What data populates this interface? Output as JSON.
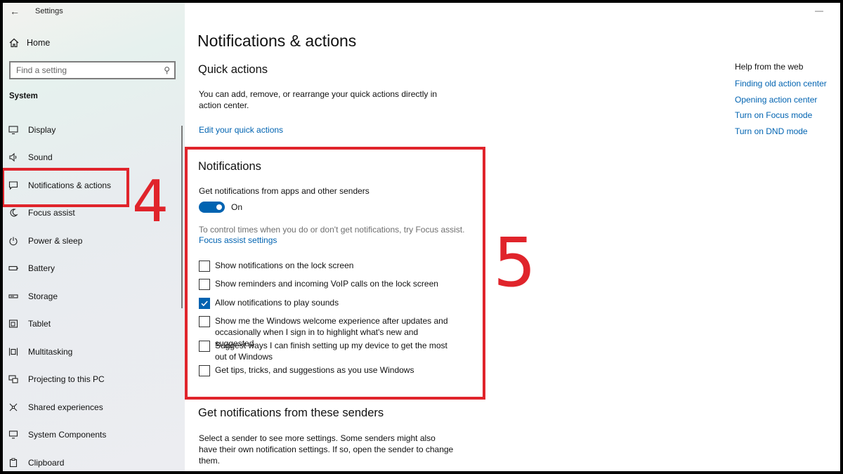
{
  "window": {
    "title": "Settings"
  },
  "sidebar": {
    "home_label": "Home",
    "search_placeholder": "Find a setting",
    "section_label": "System",
    "items": [
      {
        "label": "Display",
        "icon": "monitor-icon"
      },
      {
        "label": "Sound",
        "icon": "speaker-icon"
      },
      {
        "label": "Notifications & actions",
        "icon": "notification-icon"
      },
      {
        "label": "Focus assist",
        "icon": "moon-icon"
      },
      {
        "label": "Power & sleep",
        "icon": "power-icon"
      },
      {
        "label": "Battery",
        "icon": "battery-icon"
      },
      {
        "label": "Storage",
        "icon": "storage-icon"
      },
      {
        "label": "Tablet",
        "icon": "tablet-icon"
      },
      {
        "label": "Multitasking",
        "icon": "multitasking-icon"
      },
      {
        "label": "Projecting to this PC",
        "icon": "projecting-icon"
      },
      {
        "label": "Shared experiences",
        "icon": "shared-icon"
      },
      {
        "label": "System Components",
        "icon": "components-icon"
      },
      {
        "label": "Clipboard",
        "icon": "clipboard-icon"
      }
    ]
  },
  "main": {
    "page_title": "Notifications & actions",
    "quick_actions": {
      "heading": "Quick actions",
      "description": "You can add, remove, or rearrange your quick actions directly in action center.",
      "link": "Edit your quick actions"
    },
    "notifications": {
      "heading": "Notifications",
      "toggle_label_text": "Get notifications from apps and other senders",
      "toggle_state": "On",
      "focus_hint": "To control times when you do or don't get notifications, try Focus assist.",
      "focus_link": "Focus assist settings",
      "options": [
        {
          "label": "Show notifications on the lock screen",
          "checked": false
        },
        {
          "label": "Show reminders and incoming VoIP calls on the lock screen",
          "checked": false
        },
        {
          "label": "Allow notifications to play sounds",
          "checked": true
        },
        {
          "label": "Show me the Windows welcome experience after updates and occasionally when I sign in to highlight what's new and suggested",
          "checked": false
        },
        {
          "label": "Suggest ways I can finish setting up my device to get the most out of Windows",
          "checked": false
        },
        {
          "label": "Get tips, tricks, and suggestions as you use Windows",
          "checked": false
        }
      ]
    },
    "senders": {
      "heading": "Get notifications from these senders",
      "description": "Select a sender to see more settings. Some senders might also have their own notification settings. If so, open the sender to change them."
    }
  },
  "help": {
    "title": "Help from the web",
    "links": [
      "Finding old action center",
      "Opening action center",
      "Turn on Focus mode",
      "Turn on DND mode"
    ]
  },
  "annotations": {
    "step_4": "4",
    "step_5": "5",
    "color": "#e0242b"
  },
  "colors": {
    "accent": "#0063b1"
  }
}
